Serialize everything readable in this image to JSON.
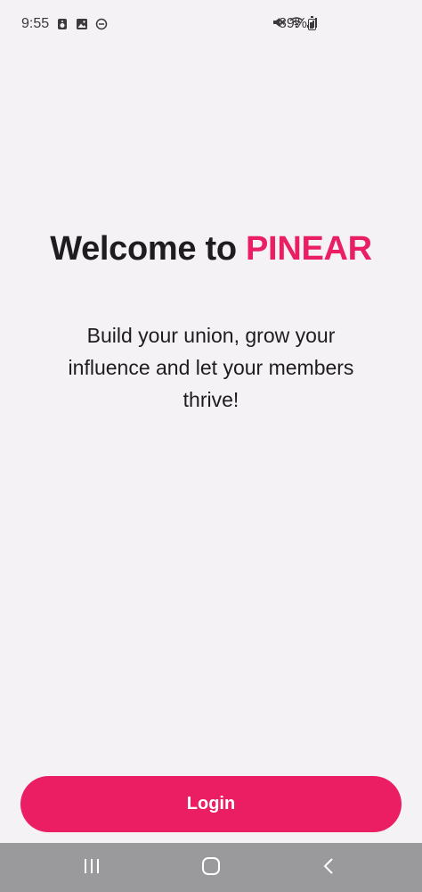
{
  "status_bar": {
    "time": "9:55",
    "battery": "89%"
  },
  "welcome": {
    "title_prefix": "Welcome to ",
    "brand": "PINEAR",
    "tagline": "Build your union, grow your influence and let your members thrive!"
  },
  "actions": {
    "login_label": "Login"
  },
  "colors": {
    "accent": "#e91e63",
    "background": "#f4f2f5",
    "nav_bar": "#9a999c"
  },
  "icons": {
    "status_left": [
      "speaker-icon",
      "image-icon",
      "do-not-disturb-icon"
    ],
    "status_right": [
      "mute-icon",
      "wifi-icon",
      "signal-icon",
      "battery-icon"
    ],
    "nav": [
      "recent-apps-icon",
      "home-icon",
      "back-icon"
    ]
  }
}
